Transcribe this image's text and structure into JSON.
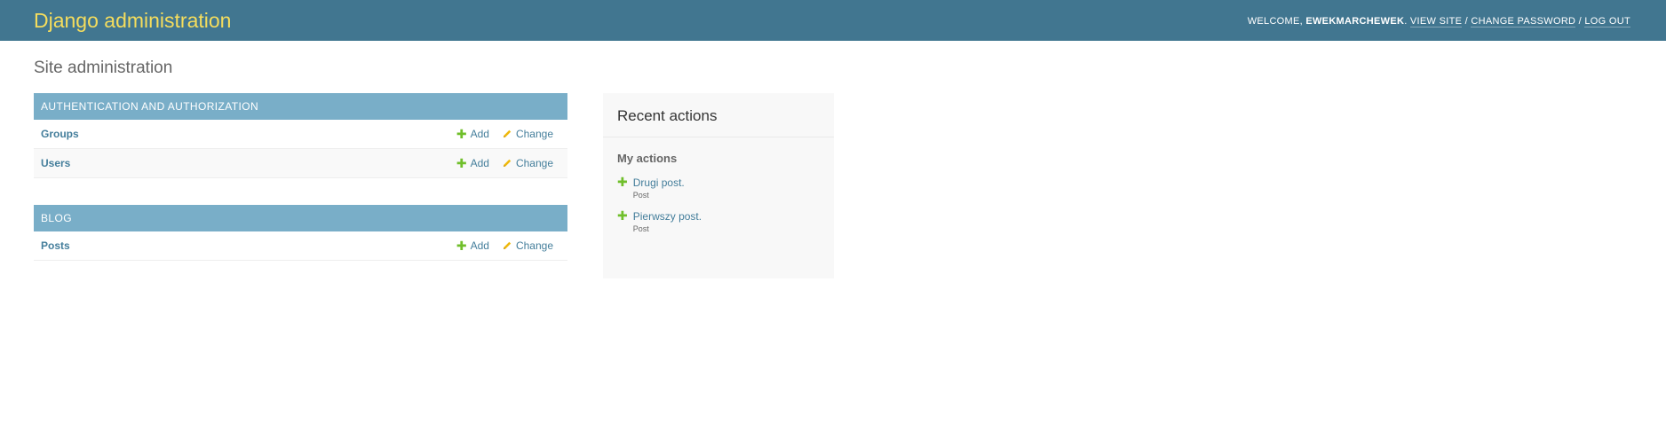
{
  "header": {
    "branding": "Django administration",
    "welcome": "WELCOME,",
    "username": "EWEKMARCHEWEK",
    "view_site": "VIEW SITE",
    "change_password": "CHANGE PASSWORD",
    "log_out": "LOG OUT",
    "separator": "/"
  },
  "page": {
    "title": "Site administration"
  },
  "modules": [
    {
      "caption": "AUTHENTICATION AND AUTHORIZATION",
      "models": [
        {
          "name": "Groups",
          "add": "Add",
          "change": "Change"
        },
        {
          "name": "Users",
          "add": "Add",
          "change": "Change"
        }
      ]
    },
    {
      "caption": "BLOG",
      "models": [
        {
          "name": "Posts",
          "add": "Add",
          "change": "Change"
        }
      ]
    }
  ],
  "recent_actions": {
    "title": "Recent actions",
    "subtitle": "My actions",
    "items": [
      {
        "label": "Drugi post.",
        "type": "Post",
        "icon": "add-icon"
      },
      {
        "label": "Pierwszy post.",
        "type": "Post",
        "icon": "add-icon"
      }
    ]
  },
  "colors": {
    "header_bg": "#417690",
    "branding": "#f5dd5d",
    "module_caption_bg": "#79aec8",
    "link": "#447e9b",
    "add_icon": "#70bf2b",
    "change_icon": "#efb80b"
  }
}
